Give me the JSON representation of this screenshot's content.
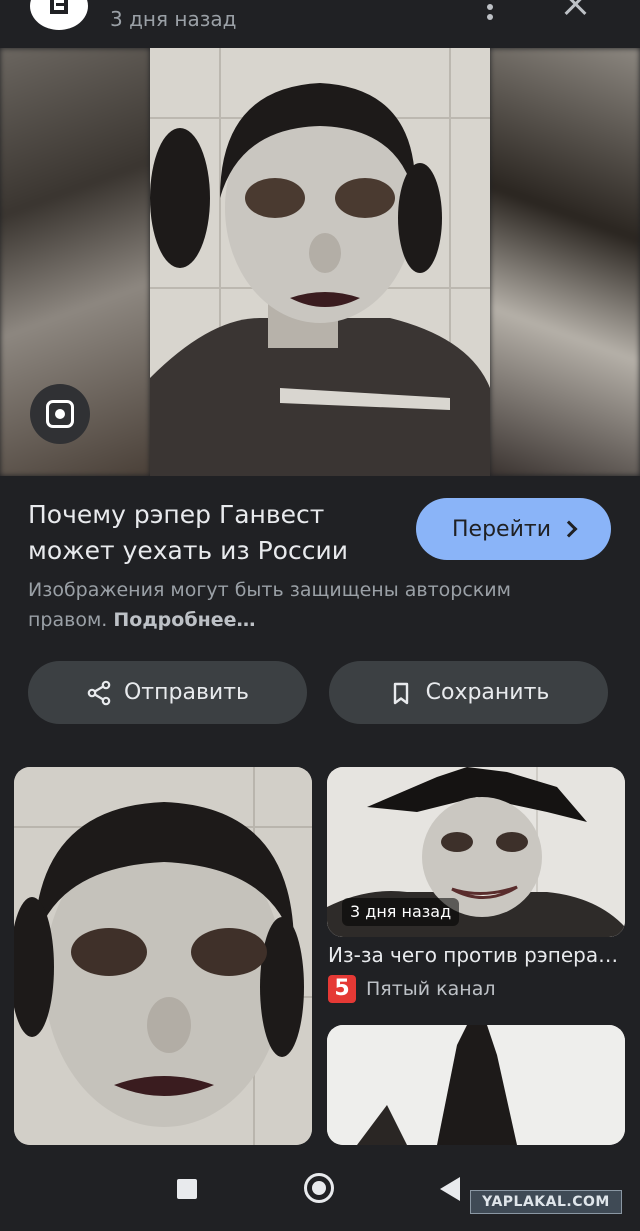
{
  "header": {
    "time_ago": "3 дня назад",
    "source_logo_icon": "article-icon",
    "menu_icon": "kebab-menu-icon",
    "close_icon": "close-icon"
  },
  "hero": {
    "lens_icon": "google-lens-icon"
  },
  "result": {
    "title": "Почему рэпер Ганвест может уехать из России",
    "visit_label": "Перейти",
    "copyright_text": "Изображения могут быть защищены авторским правом.",
    "more_label": "Подробнее…"
  },
  "actions": {
    "share_label": "Отправить",
    "save_label": "Сохранить"
  },
  "related": [
    {},
    {
      "time_badge": "3 дня назад",
      "title": "Из-за чего против рэпера…",
      "source_logo_text": "5",
      "source_name": "Пятый канал"
    },
    {}
  ],
  "navbar": {
    "icons": [
      "recents-icon",
      "home-icon",
      "back-icon"
    ]
  },
  "watermark": "YAPLAKAL.COM",
  "colors": {
    "background": "#202124",
    "accent": "#8ab4f8",
    "pill": "#3c4043",
    "channel_red": "#e53935"
  }
}
